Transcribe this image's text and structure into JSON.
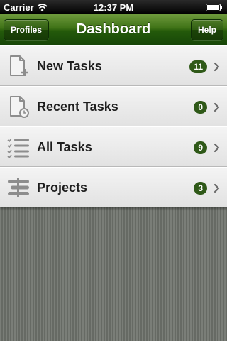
{
  "status_bar": {
    "carrier": "Carrier",
    "time": "12:37 PM"
  },
  "nav": {
    "title": "Dashboard",
    "left_button": "Profiles",
    "right_button": "Help"
  },
  "menu": [
    {
      "label": "New Tasks",
      "count": "11",
      "icon": "new-task-icon"
    },
    {
      "label": "Recent Tasks",
      "count": "0",
      "icon": "recent-task-icon"
    },
    {
      "label": "All Tasks",
      "count": "9",
      "icon": "checklist-icon"
    },
    {
      "label": "Projects",
      "count": "3",
      "icon": "projects-icon"
    }
  ],
  "colors": {
    "nav_green": "#245a0a",
    "badge_green": "#2f5918",
    "row_background": "#ececec",
    "backdrop": "#6f736d"
  }
}
